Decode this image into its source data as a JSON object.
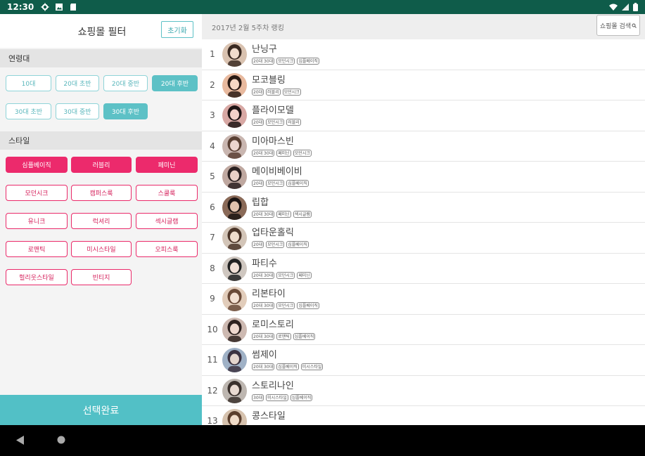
{
  "status_bar": {
    "time": "12:30",
    "left_icons": [
      "gear-icon",
      "photo-icon",
      "sd-card-icon"
    ],
    "right_icons": [
      "wifi-icon",
      "signal-icon",
      "battery-icon"
    ]
  },
  "filter": {
    "title": "쇼핑몰 필터",
    "reset_label": "초기화",
    "age_section_label": "연령대",
    "age_options": [
      {
        "label": "10대",
        "selected": false
      },
      {
        "label": "20대 초반",
        "selected": false
      },
      {
        "label": "20대 중반",
        "selected": false
      },
      {
        "label": "20대 후반",
        "selected": true
      },
      {
        "label": "30대 초반",
        "selected": false
      },
      {
        "label": "30대 중반",
        "selected": false
      },
      {
        "label": "30대 후반",
        "selected": true
      }
    ],
    "style_section_label": "스타일",
    "style_options": [
      {
        "label": "심플베이직",
        "selected": true
      },
      {
        "label": "러블리",
        "selected": true
      },
      {
        "label": "페미닌",
        "selected": true
      },
      {
        "label": "모던시크",
        "selected": false
      },
      {
        "label": "캠퍼스룩",
        "selected": false
      },
      {
        "label": "스쿨룩",
        "selected": false
      },
      {
        "label": "유니크",
        "selected": false
      },
      {
        "label": "럭셔리",
        "selected": false
      },
      {
        "label": "섹시글램",
        "selected": false
      },
      {
        "label": "로맨틱",
        "selected": false
      },
      {
        "label": "미시스타일",
        "selected": false
      },
      {
        "label": "오피스룩",
        "selected": false
      },
      {
        "label": "헐리웃스타일",
        "selected": false
      },
      {
        "label": "빈티지",
        "selected": false
      }
    ],
    "done_label": "선택완료"
  },
  "ranking": {
    "week_label": "2017년 2월 5주차 랭킹",
    "search_label": "쇼핑몰 검색",
    "items": [
      {
        "rank": "1",
        "name": "난닝구",
        "tags": [
          "20대 30대",
          "모던시크",
          "심플베이직"
        ]
      },
      {
        "rank": "2",
        "name": "모코블링",
        "tags": [
          "20대",
          "러블리",
          "모던시크"
        ]
      },
      {
        "rank": "3",
        "name": "플라이모델",
        "tags": [
          "20대",
          "모던시크",
          "러블리"
        ]
      },
      {
        "rank": "4",
        "name": "미아마스빈",
        "tags": [
          "20대 30대",
          "페미닌",
          "모던시크"
        ]
      },
      {
        "rank": "5",
        "name": "메이비베이비",
        "tags": [
          "20대",
          "모던시크",
          "심플베이직"
        ]
      },
      {
        "rank": "6",
        "name": "립합",
        "tags": [
          "20대 30대",
          "페미닌",
          "섹시글램"
        ]
      },
      {
        "rank": "7",
        "name": "업타운홀릭",
        "tags": [
          "20대",
          "모던시크",
          "심플베이직"
        ]
      },
      {
        "rank": "8",
        "name": "파티수",
        "tags": [
          "20대 30대",
          "모던시크",
          "페미닌"
        ]
      },
      {
        "rank": "9",
        "name": "리본타이",
        "tags": [
          "20대 30대",
          "모던시크",
          "심플베이직"
        ]
      },
      {
        "rank": "10",
        "name": "로미스토리",
        "tags": [
          "20대 30대",
          "로맨틱",
          "심플베이직"
        ]
      },
      {
        "rank": "11",
        "name": "썸제이",
        "tags": [
          "20대 30대",
          "심플베이직",
          "미시스타일"
        ]
      },
      {
        "rank": "12",
        "name": "스토리나인",
        "tags": [
          "30대",
          "미시스타일",
          "심플베이직"
        ]
      },
      {
        "rank": "13",
        "name": "콩스타일",
        "tags": [
          "",
          "",
          ""
        ]
      }
    ]
  },
  "nav_bar": {
    "icons": [
      "back-icon",
      "home-icon"
    ]
  },
  "colors": {
    "status_bar": "#0f5c4a",
    "teal_accent": "#5dc1c6",
    "pink_accent": "#ec2a6c"
  }
}
